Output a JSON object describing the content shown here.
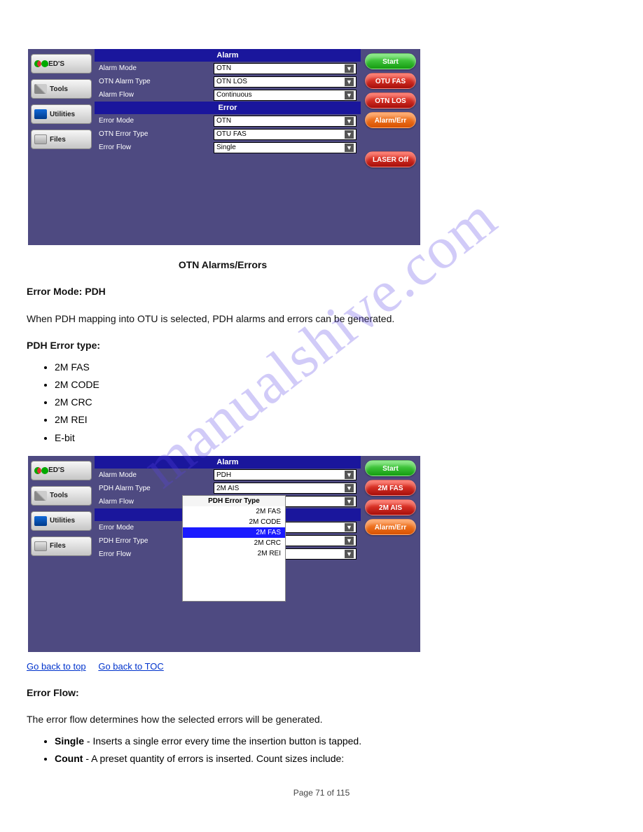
{
  "watermark": "manualshive.com",
  "panel1": {
    "sidebar": [
      {
        "label": "LED'S",
        "icon": "ic-leds"
      },
      {
        "label": "Tools",
        "icon": "ic-tools"
      },
      {
        "label": "Utilities",
        "icon": "ic-util"
      },
      {
        "label": "Files",
        "icon": "ic-files"
      }
    ],
    "alarm_header": "Alarm",
    "error_header": "Error",
    "alarm_rows": [
      {
        "label": "Alarm Mode",
        "value": "OTN"
      },
      {
        "label": "OTN Alarm Type",
        "value": "OTN LOS"
      },
      {
        "label": "Alarm Flow",
        "value": "Continuous"
      }
    ],
    "error_rows": [
      {
        "label": "Error Mode",
        "value": "OTN"
      },
      {
        "label": "OTN Error Type",
        "value": "OTU FAS"
      },
      {
        "label": "Error Flow",
        "value": "Single"
      }
    ],
    "right": [
      {
        "label": "Start",
        "cls": "green"
      },
      {
        "label": "OTU FAS",
        "cls": "red"
      },
      {
        "label": "OTN LOS",
        "cls": "red"
      },
      {
        "label": "Alarm/Err",
        "cls": "orange"
      },
      {
        "label": "LASER Off",
        "cls": "red",
        "gap": true
      }
    ]
  },
  "middle_text": {
    "heading": "OTN Alarms/Errors",
    "error_mode_heading": "Error Mode: PDH",
    "lead": "When PDH mapping into OTU is selected, PDH alarms and errors can be generated.",
    "pdh_error_type_label": "PDH Error type:",
    "list": [
      "2M FAS",
      "2M CODE",
      "2M CRC",
      "2M REI",
      "E-bit"
    ]
  },
  "panel2": {
    "sidebar": [
      {
        "label": "LED'S",
        "icon": "ic-leds"
      },
      {
        "label": "Tools",
        "icon": "ic-tools"
      },
      {
        "label": "Utilities",
        "icon": "ic-util"
      },
      {
        "label": "Files",
        "icon": "ic-files"
      }
    ],
    "alarm_header": "Alarm",
    "alarm_rows": [
      {
        "label": "Alarm Mode",
        "value": "PDH"
      },
      {
        "label": "PDH Alarm Type",
        "value": "2M AIS"
      },
      {
        "label": "Alarm Flow",
        "value": ""
      }
    ],
    "error_rows_labels": [
      "Error Mode",
      "PDH Error Type",
      "Error Flow"
    ],
    "popup": {
      "title": "PDH Error Type",
      "items": [
        {
          "text": "2M FAS",
          "sel": false
        },
        {
          "text": "2M CODE",
          "sel": false
        },
        {
          "text": "2M FAS",
          "sel": true
        },
        {
          "text": "2M CRC",
          "sel": false
        },
        {
          "text": "2M REI",
          "sel": false
        }
      ]
    },
    "right": [
      {
        "label": "Start",
        "cls": "green"
      },
      {
        "label": "2M FAS",
        "cls": "red"
      },
      {
        "label": "2M AIS",
        "cls": "red"
      },
      {
        "label": "Alarm/Err",
        "cls": "orange"
      }
    ]
  },
  "footer": {
    "back_label": "Go back to top",
    "toc_label": "Go back to TOC",
    "error_flow_heading": "Error Flow:",
    "error_flow_text": "The error flow determines how the selected errors will be generated.",
    "single_label": "Single",
    "single_text": " - Inserts a single error every time the insertion button is tapped.",
    "count_label": "Count",
    "count_text": " - A preset quantity of errors is inserted. Count sizes include:",
    "page_number": "Page 71 of 115"
  }
}
